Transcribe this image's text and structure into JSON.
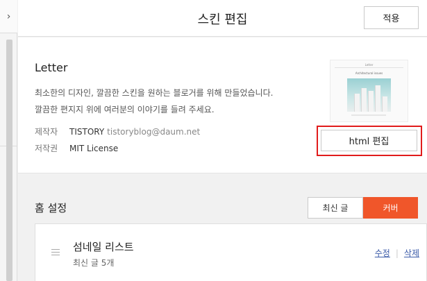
{
  "rail": {
    "toggle_icon": "chevron-right-icon",
    "toggle_glyph": "›"
  },
  "header": {
    "title": "스킨 편집",
    "apply_label": "적용"
  },
  "skin": {
    "name": "Letter",
    "description": "최소한의 디자인, 깔끔한 스킨을 원하는 블로거를 위해 만들었습니다.\n깔끔한 편지지 위에 여러분의 이야기를 들려 주세요.",
    "maker_label": "제작자",
    "maker_value": "TISTORY",
    "maker_email": "tistoryblog@daum.net",
    "license_label": "저작권",
    "license_value": "MIT License",
    "thumbnail": {
      "logo": "Letter",
      "heading": "Architectural issues"
    },
    "html_edit_label": "html 편집"
  },
  "home": {
    "label": "홈 설정",
    "options": [
      "최신 글",
      "커버"
    ],
    "selected": "커버"
  },
  "cover_item": {
    "title": "섬네일 리스트",
    "subtitle": "최신 글 5개",
    "edit_label": "수정",
    "delete_label": "삭제"
  },
  "colors": {
    "accent": "#f0562a",
    "highlight": "#e11b1b",
    "link": "#3a5aa8"
  }
}
